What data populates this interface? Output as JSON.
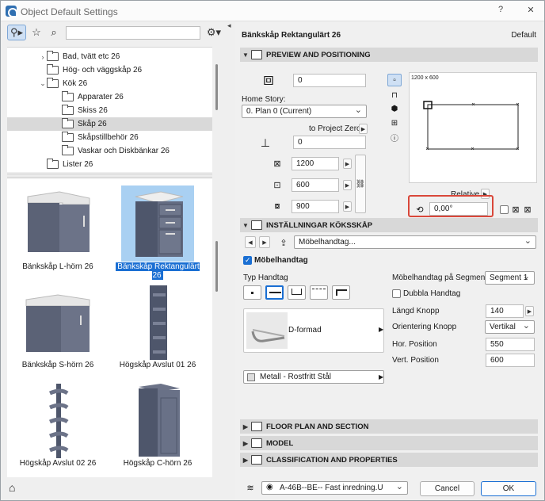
{
  "window": {
    "title": "Object Default Settings",
    "help": "?",
    "close": "✕"
  },
  "search": {
    "placeholder": ""
  },
  "tree": [
    {
      "label": "Bad, tvätt etc 26",
      "expand": "›",
      "indent": 1
    },
    {
      "label": "Hög- och väggskåp 26",
      "expand": "",
      "indent": 1
    },
    {
      "label": "Kök 26",
      "expand": "⌄",
      "indent": 1
    },
    {
      "label": "Apparater 26",
      "expand": "",
      "indent": 2
    },
    {
      "label": "Skiss 26",
      "expand": "",
      "indent": 2
    },
    {
      "label": "Skåp 26",
      "expand": "",
      "indent": 2,
      "selected": true
    },
    {
      "label": "Skåpstillbehör 26",
      "expand": "",
      "indent": 2
    },
    {
      "label": "Vaskar och Diskbänkar 26",
      "expand": "",
      "indent": 2
    },
    {
      "label": "Lister 26",
      "expand": "",
      "indent": 1
    }
  ],
  "gallery": [
    {
      "label": "Bänkskåp L-hörn 26",
      "kind": "lcorner"
    },
    {
      "label": "Bänkskåp Rektangulärt 26",
      "kind": "drawers",
      "selected": true
    },
    {
      "label": "Bänkskåp S-hörn 26",
      "kind": "scorner"
    },
    {
      "label": "Högskåp Avslut 01 26",
      "kind": "shelf"
    },
    {
      "label": "Högskåp Avslut 02 26",
      "kind": "shelf2"
    },
    {
      "label": "Högskåp C-hörn 26",
      "kind": "tall"
    }
  ],
  "right": {
    "object_name": "Bänkskåp Rektangulärt 26",
    "default_label": "Default",
    "preview_section": "PREVIEW AND POSITIONING",
    "elevation_value": "0",
    "home_story_label": "Home Story:",
    "home_story_value": "0. Plan 0 (Current)",
    "to_project_zero_label": "to Project Zero",
    "to_project_zero_value": "0",
    "width_value": "1200",
    "depth_value": "600",
    "height_value": "900",
    "preview_caption": "1200 x 600",
    "relative_label": "Relative",
    "rotation_value": "0,00°",
    "kitchen_section": "INSTÄLLNINGAR KÖKSSKÅP",
    "page_dropdown": "Möbelhandtag...",
    "handle_checkbox_label": "Möbelhandtag",
    "type_label": "Typ Handtag",
    "handle_name": "D-formad",
    "material_value": "Metall - Rostfritt Stål",
    "segment_label": "Möbelhandtag på Segment",
    "segment_value": "Segment 1",
    "double_label": "Dubbla Handtag",
    "length_label": "Längd Knopp",
    "length_value": "140",
    "orient_label": "Orientering Knopp",
    "orient_value": "Vertikal",
    "hor_label": "Hor. Position",
    "hor_value": "550",
    "vert_label": "Vert. Position",
    "vert_value": "600",
    "floor_section": "FLOOR PLAN AND SECTION",
    "model_section": "MODEL",
    "class_section": "CLASSIFICATION AND PROPERTIES",
    "layer_value": "A-46B--BE-- Fast inredning.U",
    "cancel_label": "Cancel",
    "ok_label": "OK"
  }
}
